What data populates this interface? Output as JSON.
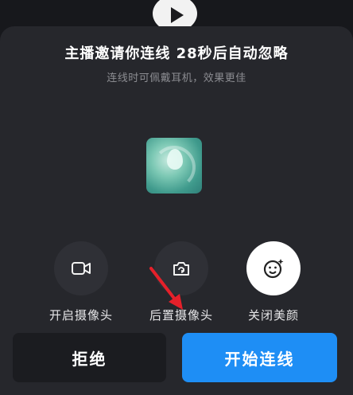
{
  "invite": {
    "title": "主播邀请你连线 28秒后自动忽略",
    "subtitle": "连线时可佩戴耳机，效果更佳"
  },
  "options": [
    {
      "label": "开启摄像头",
      "icon": "camera-icon",
      "active": false
    },
    {
      "label": "后置摄像头",
      "icon": "camera-switch-icon",
      "active": false
    },
    {
      "label": "关闭美颜",
      "icon": "beauty-face-icon",
      "active": true
    }
  ],
  "actions": {
    "reject_label": "拒绝",
    "start_label": "开始连线"
  },
  "colors": {
    "sheet": "#26272c",
    "accent": "#1e8ef5",
    "arrow": "#e5202a"
  }
}
